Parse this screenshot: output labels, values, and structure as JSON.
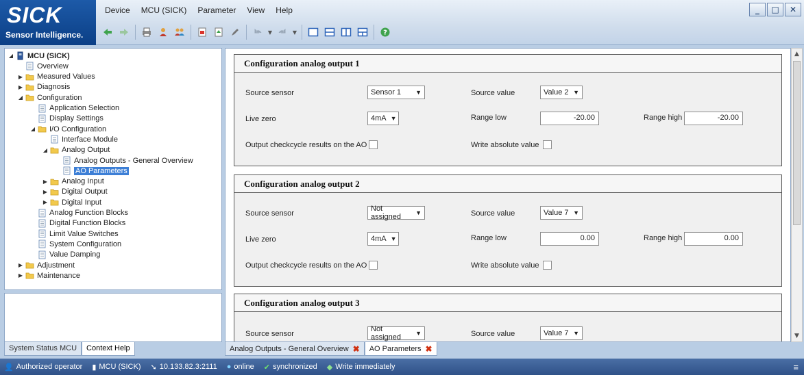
{
  "logo": {
    "brand": "SICK",
    "tagline": "Sensor Intelligence."
  },
  "menu": [
    "Device",
    "MCU (SICK)",
    "Parameter",
    "View",
    "Help"
  ],
  "window_controls": [
    "_",
    "□",
    "✕"
  ],
  "tree": [
    {
      "label": "MCU (SICK)",
      "twisty": "◢",
      "icon": "device-icon",
      "bold": true
    },
    {
      "label": "Overview",
      "twisty": "",
      "icon": "page-icon"
    },
    {
      "label": "Measured Values",
      "twisty": "▶",
      "icon": "folder-icon"
    },
    {
      "label": "Diagnosis",
      "twisty": "▶",
      "icon": "folder-icon"
    },
    {
      "label": "Configuration",
      "twisty": "◢",
      "icon": "folder-icon"
    },
    {
      "label": "Application Selection",
      "twisty": "",
      "icon": "page-icon"
    },
    {
      "label": "Display Settings",
      "twisty": "",
      "icon": "page-icon"
    },
    {
      "label": "I/O Configuration",
      "twisty": "◢",
      "icon": "folder-icon"
    },
    {
      "label": "Interface Module",
      "twisty": "",
      "icon": "page-icon"
    },
    {
      "label": "Analog Output",
      "twisty": "◢",
      "icon": "folder-icon"
    },
    {
      "label": "Analog Outputs - General Overview",
      "twisty": "",
      "icon": "page-icon"
    },
    {
      "label": "AO Parameters",
      "twisty": "",
      "icon": "page-icon",
      "selected": true
    },
    {
      "label": "Analog Input",
      "twisty": "▶",
      "icon": "folder-icon"
    },
    {
      "label": "Digital Output",
      "twisty": "▶",
      "icon": "folder-icon"
    },
    {
      "label": "Digital Input",
      "twisty": "▶",
      "icon": "folder-icon"
    },
    {
      "label": "Analog Function Blocks",
      "twisty": "",
      "icon": "page-icon"
    },
    {
      "label": "Digital Function Blocks",
      "twisty": "",
      "icon": "page-icon"
    },
    {
      "label": "Limit Value Switches",
      "twisty": "",
      "icon": "page-icon"
    },
    {
      "label": "System Configuration",
      "twisty": "",
      "icon": "page-icon"
    },
    {
      "label": "Value Damping",
      "twisty": "",
      "icon": "page-icon"
    },
    {
      "label": "Adjustment",
      "twisty": "▶",
      "icon": "folder-icon"
    },
    {
      "label": "Maintenance",
      "twisty": "▶",
      "icon": "folder-icon"
    }
  ],
  "left_tabs": [
    "System Status MCU",
    "Context Help"
  ],
  "labels": {
    "source_sensor": "Source sensor",
    "source_value": "Source value",
    "live_zero": "Live zero",
    "range_low": "Range low",
    "range_high": "Range high",
    "output_checkcycle": "Output checkcycle results on the AO",
    "write_absolute": "Write absolute value"
  },
  "sections": [
    {
      "title": "Configuration analog output 1",
      "source_sensor": "Sensor 1",
      "source_value": "Value 2",
      "live_zero": "4mA",
      "range_low": "-20.00",
      "range_high": "-20.00"
    },
    {
      "title": "Configuration analog output 2",
      "source_sensor": "Not assigned",
      "source_value": "Value 7",
      "live_zero": "4mA",
      "range_low": "0.00",
      "range_high": "0.00"
    },
    {
      "title": "Configuration analog output 3",
      "source_sensor": "Not assigned",
      "source_value": "Value 7"
    }
  ],
  "doc_tabs": [
    {
      "label": "Analog Outputs - General Overview",
      "close": "✖"
    },
    {
      "label": "AO Parameters",
      "close": "✖",
      "active": true
    }
  ],
  "status": {
    "user": "Authorized operator",
    "device": "MCU (SICK)",
    "address": "10.133.82.3:2111",
    "online": "online",
    "sync": "synchronized",
    "write_mode": "Write immediately"
  },
  "colors": {
    "brand_blue": "#0b3f86",
    "selection": "#3d7fd6",
    "folder": "#f2c94c"
  }
}
